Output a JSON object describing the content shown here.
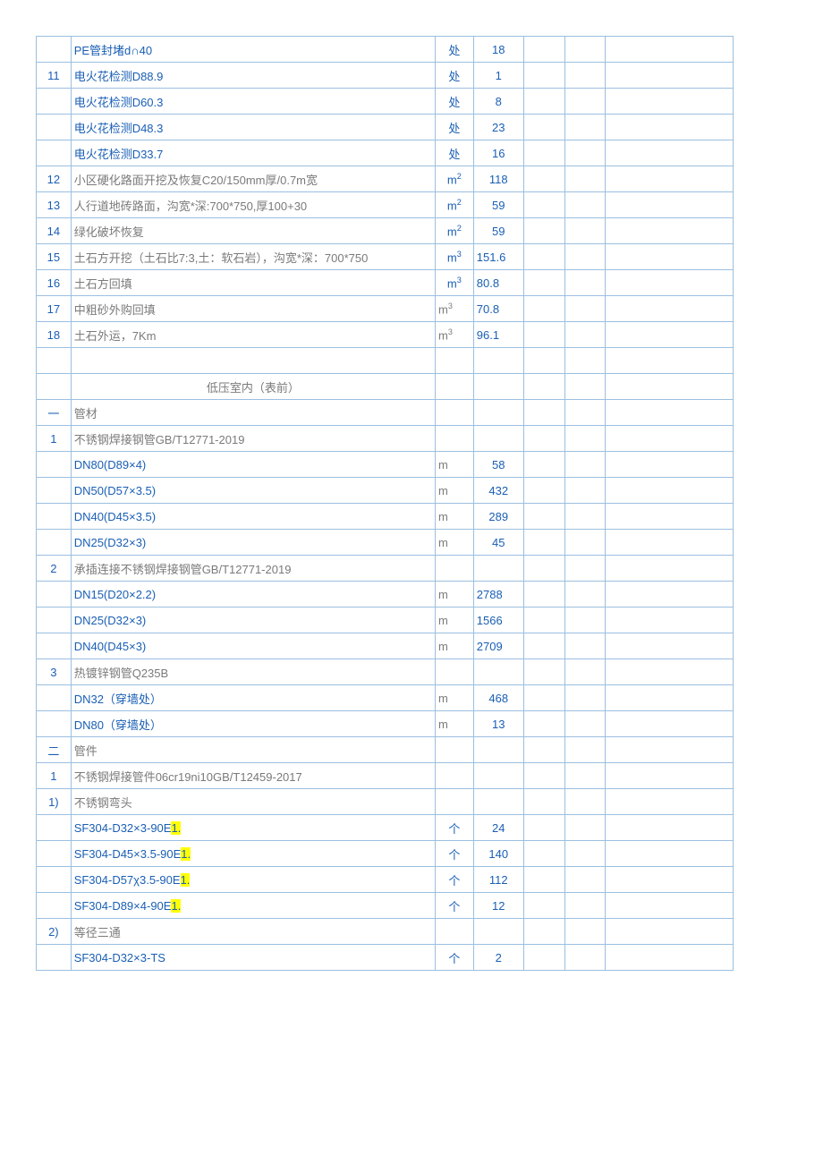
{
  "rows": [
    {
      "idx": "",
      "desc": "PE管封堵d∩40",
      "descCls": "desc",
      "unit": "处",
      "unitCls": "unit",
      "qty": "18",
      "qtyCls": "qty"
    },
    {
      "idx": "11",
      "desc": "电火花检测D88.9",
      "descCls": "desc",
      "unit": "处",
      "unitCls": "unit",
      "qty": "1",
      "qtyCls": "qty"
    },
    {
      "idx": "",
      "desc": "电火花检测D60.3",
      "descCls": "desc",
      "unit": "处",
      "unitCls": "unit",
      "qty": "8",
      "qtyCls": "qty"
    },
    {
      "idx": "",
      "desc": "电火花检测D48.3",
      "descCls": "desc",
      "unit": "处",
      "unitCls": "unit",
      "qty": "23",
      "qtyCls": "qty"
    },
    {
      "idx": "",
      "desc": "电火花检测D33.7",
      "descCls": "desc",
      "unit": "处",
      "unitCls": "unit",
      "qty": "16",
      "qtyCls": "qty"
    },
    {
      "idx": "12",
      "desc": "小区硬化路面开挖及恢复C20/150mm厚/0.7m宽",
      "descCls": "desc-gray",
      "unit": "m²",
      "unitCls": "unit",
      "unitHtml": "m<sup>2</sup>",
      "qty": "118",
      "qtyCls": "qty"
    },
    {
      "idx": "13",
      "desc": "人行道地砖路面，沟宽*深:700*750,厚100+30",
      "descCls": "desc-gray",
      "unit": "m²",
      "unitCls": "unit",
      "unitHtml": "m<sup>2</sup>",
      "qty": "59",
      "qtyCls": "qty"
    },
    {
      "idx": "14",
      "desc": "绿化破坏恢复",
      "descCls": "desc-gray",
      "unit": "m²",
      "unitCls": "unit",
      "unitHtml": "m<sup>2</sup>",
      "qty": "59",
      "qtyCls": "qty"
    },
    {
      "idx": "15",
      "desc": "土石方开挖（土石比7:3,土：软石岩），沟宽*深：700*750",
      "descCls": "desc-gray",
      "unit": "m³",
      "unitCls": "unit",
      "unitHtml": "m<sup>3</sup>",
      "qty": "151.6",
      "qtyCls": "qty-left"
    },
    {
      "idx": "16",
      "desc": "土石方回填",
      "descCls": "desc-gray",
      "unit": "m³",
      "unitCls": "unit",
      "unitHtml": "m<sup>3</sup>",
      "qty": "80.8",
      "qtyCls": "qty-left"
    },
    {
      "idx": "17",
      "desc": "中粗砂外购回填",
      "descCls": "desc-gray",
      "unit": "m³",
      "unitCls": "unit-left",
      "unitHtml": "m<sup>3</sup>",
      "qty": "70.8",
      "qtyCls": "qty-left"
    },
    {
      "idx": "18",
      "desc": "土石外运，7Km",
      "descCls": "desc-gray",
      "unit": "m³",
      "unitCls": "unit-left",
      "unitHtml": "m<sup>3</sup>",
      "qty": "96.1",
      "qtyCls": "qty-left"
    },
    {
      "blank": true
    },
    {
      "idx": "",
      "desc": "低压室内（表前）",
      "descCls": "section-title",
      "unit": "",
      "qty": ""
    },
    {
      "idx": "一",
      "desc": "管材",
      "descCls": "desc-gray",
      "unit": "",
      "qty": ""
    },
    {
      "idx": "1",
      "desc": "不锈钢焊接钢管GB/T12771-2019",
      "descCls": "desc-gray",
      "unit": "",
      "qty": ""
    },
    {
      "idx": "",
      "desc": "DN80(D89×4)",
      "descCls": "desc",
      "unit": "m",
      "unitCls": "unit-left",
      "qty": "58",
      "qtyCls": "qty"
    },
    {
      "idx": "",
      "desc": "DN50(D57×3.5)",
      "descCls": "desc",
      "unit": "m",
      "unitCls": "unit-left",
      "qty": "432",
      "qtyCls": "qty"
    },
    {
      "idx": "",
      "desc": "DN40(D45×3.5)",
      "descCls": "desc",
      "unit": "m",
      "unitCls": "unit-left",
      "qty": "289",
      "qtyCls": "qty"
    },
    {
      "idx": "",
      "desc": "DN25(D32×3)",
      "descCls": "desc",
      "unit": "m",
      "unitCls": "unit-left",
      "qty": "45",
      "qtyCls": "qty"
    },
    {
      "idx": "2",
      "desc": "承插连接不锈钢焊接钢管GB/T12771-2019",
      "descCls": "desc-gray",
      "unit": "",
      "qty": ""
    },
    {
      "idx": "",
      "desc": "DN15(D20×2.2)",
      "descCls": "desc",
      "unit": "m",
      "unitCls": "unit-left",
      "qty": "2788",
      "qtyCls": "qty-left"
    },
    {
      "idx": "",
      "desc": "DN25(D32×3)",
      "descCls": "desc",
      "unit": "m",
      "unitCls": "unit-left",
      "qty": "1566",
      "qtyCls": "qty-left"
    },
    {
      "idx": "",
      "desc": "DN40(D45×3)",
      "descCls": "desc",
      "unit": "m",
      "unitCls": "unit-left",
      "qty": "2709",
      "qtyCls": "qty-left"
    },
    {
      "idx": "3",
      "desc": "热镀锌钢管Q235B",
      "descCls": "desc-gray",
      "unit": "",
      "qty": ""
    },
    {
      "idx": "",
      "desc": "DN32（穿墙处）",
      "descCls": "desc",
      "unit": "m",
      "unitCls": "unit-left",
      "qty": "468",
      "qtyCls": "qty"
    },
    {
      "idx": "",
      "desc": "DN80（穿墙处）",
      "descCls": "desc",
      "unit": "m",
      "unitCls": "unit-left",
      "qty": "13",
      "qtyCls": "qty"
    },
    {
      "idx": "二",
      "desc": "管件",
      "descCls": "desc-gray",
      "unit": "",
      "qty": ""
    },
    {
      "idx": "1",
      "desc": "不锈钢焊接管件06cr19ni10GB/T12459-2017",
      "descCls": "desc-gray",
      "unit": "",
      "qty": ""
    },
    {
      "idx": "1)",
      "idxCls": "idx-sub",
      "desc": "不锈钢弯头",
      "descCls": "desc-gray",
      "unit": "",
      "qty": ""
    },
    {
      "idx": "",
      "desc": "SF304-D32×3-90E",
      "descSuffixHl": "1.",
      "descCls": "desc",
      "unit": "个",
      "unitCls": "unit",
      "qty": "24",
      "qtyCls": "qty"
    },
    {
      "idx": "",
      "desc": "SF304-D45×3.5-90E",
      "descSuffixHl": "1.",
      "descCls": "desc",
      "unit": "个",
      "unitCls": "unit",
      "qty": "140",
      "qtyCls": "qty"
    },
    {
      "idx": "",
      "desc": "SF304-D57χ3.5-90E",
      "descSuffixHl": "1.",
      "descCls": "desc",
      "unit": "个",
      "unitCls": "unit",
      "qty": "112",
      "qtyCls": "qty"
    },
    {
      "idx": "",
      "desc": "SF304-D89×4-90E",
      "descSuffixHl": "1.",
      "descCls": "desc",
      "unit": "个",
      "unitCls": "unit",
      "qty": "12",
      "qtyCls": "qty"
    },
    {
      "idx": "2)",
      "idxCls": "idx-sub",
      "desc": "等径三通",
      "descCls": "desc-gray",
      "unit": "",
      "qty": ""
    },
    {
      "idx": "",
      "desc": "SF304-D32×3-TS",
      "descCls": "desc",
      "unit": "个",
      "unitCls": "unit",
      "qty": "2",
      "qtyCls": "qty"
    }
  ]
}
